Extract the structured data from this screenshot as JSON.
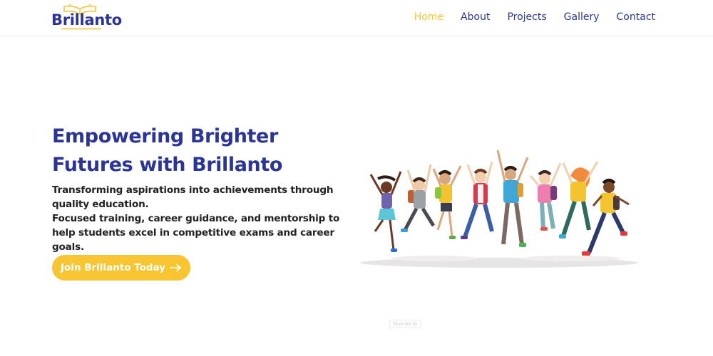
{
  "brand": {
    "name": "Brillanto",
    "color": "#2b3595",
    "accent": "#f4c430"
  },
  "nav": {
    "items": [
      {
        "label": "Home",
        "active": true
      },
      {
        "label": "About",
        "active": false
      },
      {
        "label": "Projects",
        "active": false
      },
      {
        "label": "Gallery",
        "active": false
      },
      {
        "label": "Contact",
        "active": false
      }
    ]
  },
  "hero": {
    "title": "Empowering Brighter Futures with Brillanto",
    "description": [
      "Transforming aspirations into achievements through quality education.",
      "Focused training, career guidance, and mentorship to help students excel in competitive exams and career goals."
    ],
    "cta_label": "Join Brillanto Today",
    "cta_icon": "arrow-right-icon"
  },
  "illustration": {
    "icon": "jumping-students-illustration"
  },
  "watermark": {
    "text": "favicon.io"
  }
}
